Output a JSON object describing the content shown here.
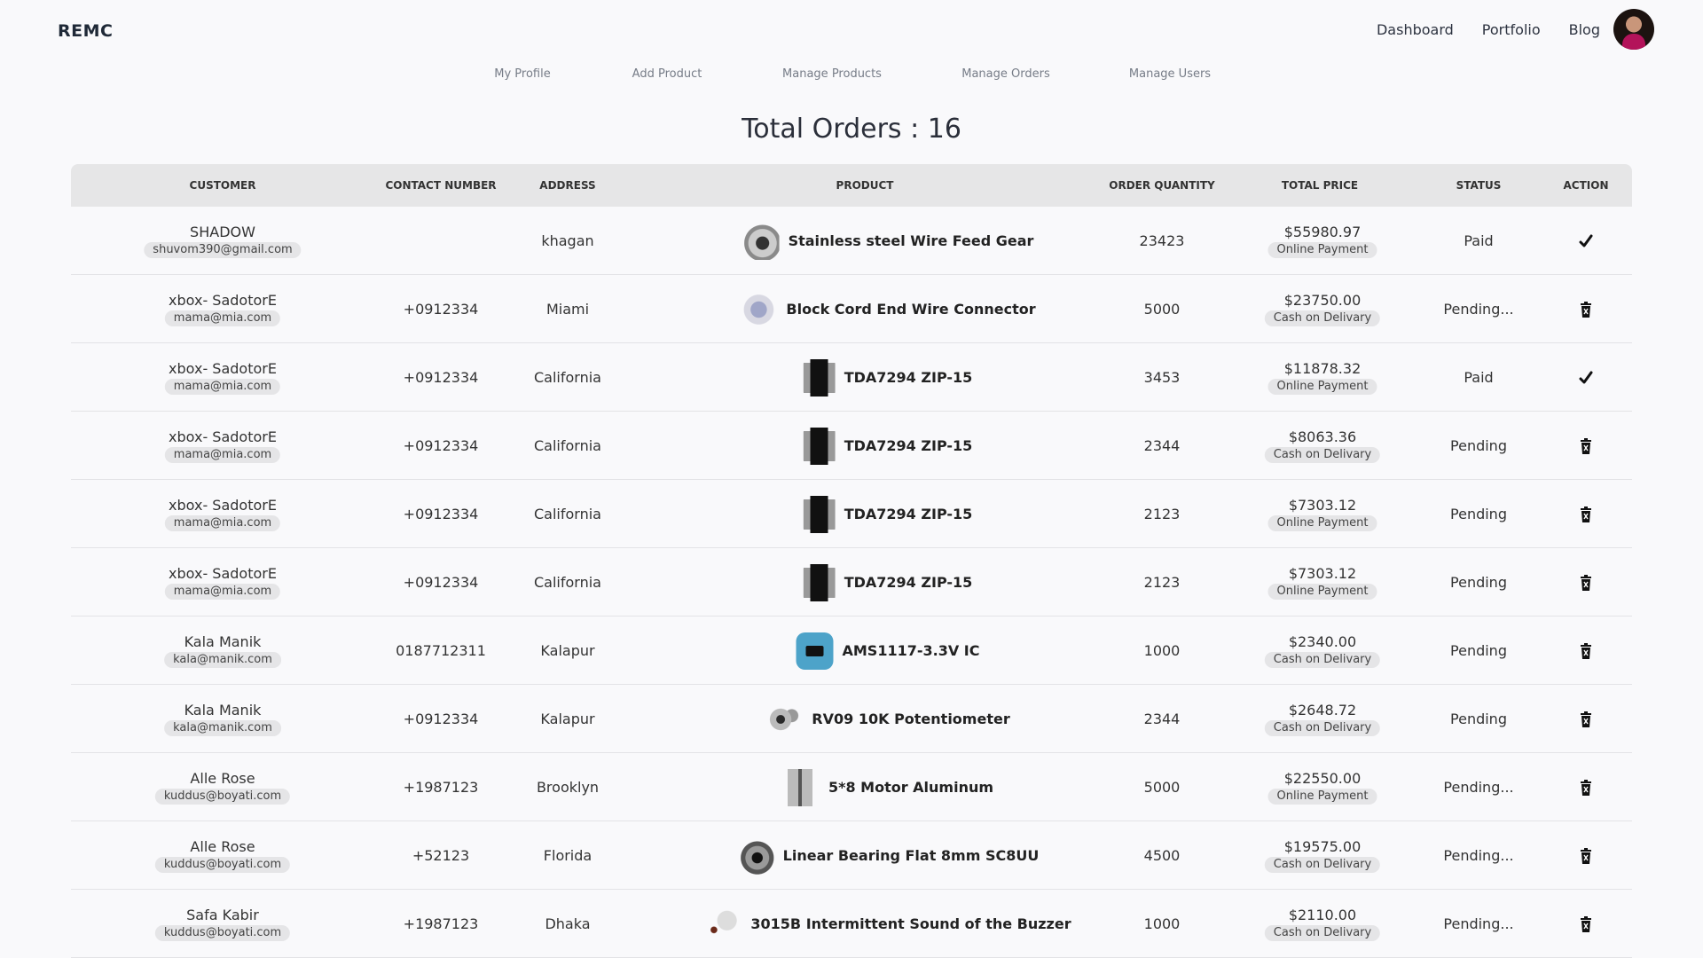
{
  "brand": "REMC",
  "nav": {
    "dashboard": "Dashboard",
    "portfolio": "Portfolio",
    "blog": "Blog"
  },
  "subnav": {
    "my_profile": "My Profile",
    "add_product": "Add Product",
    "manage_products": "Manage Products",
    "manage_orders": "Manage Orders",
    "manage_users": "Manage Users"
  },
  "heading": "Total Orders : 16",
  "table": {
    "headers": [
      "CUSTOMER",
      "CONTACT NUMBER",
      "ADDRESS",
      "PRODUCT",
      "ORDER QUANTITY",
      "TOTAL PRICE",
      "STATUS",
      "ACTION"
    ],
    "rows": [
      {
        "customer": "SHADOW",
        "email": "shuvom390@gmail.com",
        "contact": "",
        "address": "khagan",
        "product": "Stainless steel Wire Feed Gear",
        "product_icon": "gear",
        "quantity": "23423",
        "price": "$55980.97",
        "payment": "Online Payment",
        "status": "Paid",
        "action": "check-icon"
      },
      {
        "customer": "xbox- SadotorE",
        "email": "mama@mia.com",
        "contact": "+0912334",
        "address": "Miami",
        "product": "Block Cord End Wire Connector",
        "product_icon": "wire",
        "quantity": "5000",
        "price": "$23750.00",
        "payment": "Cash on Delivary",
        "status": "Pending...",
        "action": "trash-icon"
      },
      {
        "customer": "xbox- SadotorE",
        "email": "mama@mia.com",
        "contact": "+0912334",
        "address": "California",
        "product": "TDA7294 ZIP-15",
        "product_icon": "chip",
        "quantity": "3453",
        "price": "$11878.32",
        "payment": "Online Payment",
        "status": "Paid",
        "action": "check-icon"
      },
      {
        "customer": "xbox- SadotorE",
        "email": "mama@mia.com",
        "contact": "+0912334",
        "address": "California",
        "product": "TDA7294 ZIP-15",
        "product_icon": "chip",
        "quantity": "2344",
        "price": "$8063.36",
        "payment": "Cash on Delivary",
        "status": "Pending",
        "action": "trash-icon"
      },
      {
        "customer": "xbox- SadotorE",
        "email": "mama@mia.com",
        "contact": "+0912334",
        "address": "California",
        "product": "TDA7294 ZIP-15",
        "product_icon": "chip",
        "quantity": "2123",
        "price": "$7303.12",
        "payment": "Online Payment",
        "status": "Pending",
        "action": "trash-icon"
      },
      {
        "customer": "xbox- SadotorE",
        "email": "mama@mia.com",
        "contact": "+0912334",
        "address": "California",
        "product": "TDA7294 ZIP-15",
        "product_icon": "chip",
        "quantity": "2123",
        "price": "$7303.12",
        "payment": "Online Payment",
        "status": "Pending",
        "action": "trash-icon"
      },
      {
        "customer": "Kala Manik",
        "email": "kala@manik.com",
        "contact": "0187712311",
        "address": "Kalapur",
        "product": "AMS1117-3.3V IC",
        "product_icon": "ams",
        "quantity": "1000",
        "price": "$2340.00",
        "payment": "Cash on Delivary",
        "status": "Pending",
        "action": "trash-icon"
      },
      {
        "customer": "Kala Manik",
        "email": "kala@manik.com",
        "contact": "+0912334",
        "address": "Kalapur",
        "product": "RV09 10K Potentiometer",
        "product_icon": "pot",
        "quantity": "2344",
        "price": "$2648.72",
        "payment": "Cash on Delivary",
        "status": "Pending",
        "action": "trash-icon"
      },
      {
        "customer": "Alle Rose",
        "email": "kuddus@boyati.com",
        "contact": "+1987123",
        "address": "Brooklyn",
        "product": "5*8 Motor Aluminum",
        "product_icon": "motor",
        "quantity": "5000",
        "price": "$22550.00",
        "payment": "Online Payment",
        "status": "Pending...",
        "action": "trash-icon"
      },
      {
        "customer": "Alle Rose",
        "email": "kuddus@boyati.com",
        "contact": "+52123",
        "address": "Florida",
        "product": "Linear Bearing Flat 8mm SC8UU",
        "product_icon": "bearing",
        "quantity": "4500",
        "price": "$19575.00",
        "payment": "Cash on Delivary",
        "status": "Pending...",
        "action": "trash-icon"
      },
      {
        "customer": "Safa Kabir",
        "email": "kuddus@boyati.com",
        "contact": "+1987123",
        "address": "Dhaka",
        "product": "3015B Intermittent Sound of the Buzzer",
        "product_icon": "buzzer",
        "quantity": "1000",
        "price": "$2110.00",
        "payment": "Cash on Delivary",
        "status": "Pending...",
        "action": "trash-icon"
      }
    ]
  }
}
